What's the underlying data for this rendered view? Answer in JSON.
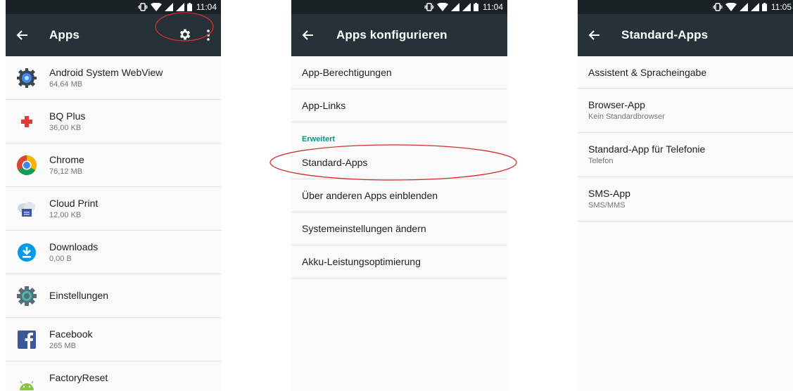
{
  "screens": [
    {
      "time": "11:04",
      "title": "Apps",
      "apps": [
        {
          "name": "Android System WebView",
          "size": "64,64 MB",
          "icon": "webview-icon"
        },
        {
          "name": "BQ Plus",
          "size": "36,00 KB",
          "icon": "bq-plus-icon"
        },
        {
          "name": "Chrome",
          "size": "76,12 MB",
          "icon": "chrome-icon"
        },
        {
          "name": "Cloud Print",
          "size": "12,00 KB",
          "icon": "cloud-print-icon"
        },
        {
          "name": "Downloads",
          "size": "0,00 B",
          "icon": "downloads-icon"
        },
        {
          "name": "Einstellungen",
          "size": "",
          "icon": "settings-app-icon"
        },
        {
          "name": "Facebook",
          "size": "265 MB",
          "icon": "facebook-icon"
        },
        {
          "name": "FactoryReset",
          "size": "",
          "icon": "android-icon"
        }
      ]
    },
    {
      "time": "11:04",
      "title": "Apps konfigurieren",
      "items": [
        "App-Berechtigungen",
        "App-Links"
      ],
      "section": "Erweitert",
      "advanced_items": [
        "Standard-Apps",
        "Über anderen Apps einblenden",
        "Systemeinstellungen ändern",
        "Akku-Leistungsoptimierung"
      ]
    },
    {
      "time": "11:05",
      "title": "Standard-Apps",
      "items": [
        {
          "title": "Assistent & Spracheingabe",
          "sub": ""
        },
        {
          "title": "Browser-App",
          "sub": "Kein Standardbrowser"
        },
        {
          "title": "Standard-App für Telefonie",
          "sub": "Telefon"
        },
        {
          "title": "SMS-App",
          "sub": "SMS/MMS"
        }
      ]
    }
  ],
  "colors": {
    "statusbar": "#1a2125",
    "appbar": "#263238",
    "accent": "#009688",
    "highlight": "#d32f2f"
  }
}
